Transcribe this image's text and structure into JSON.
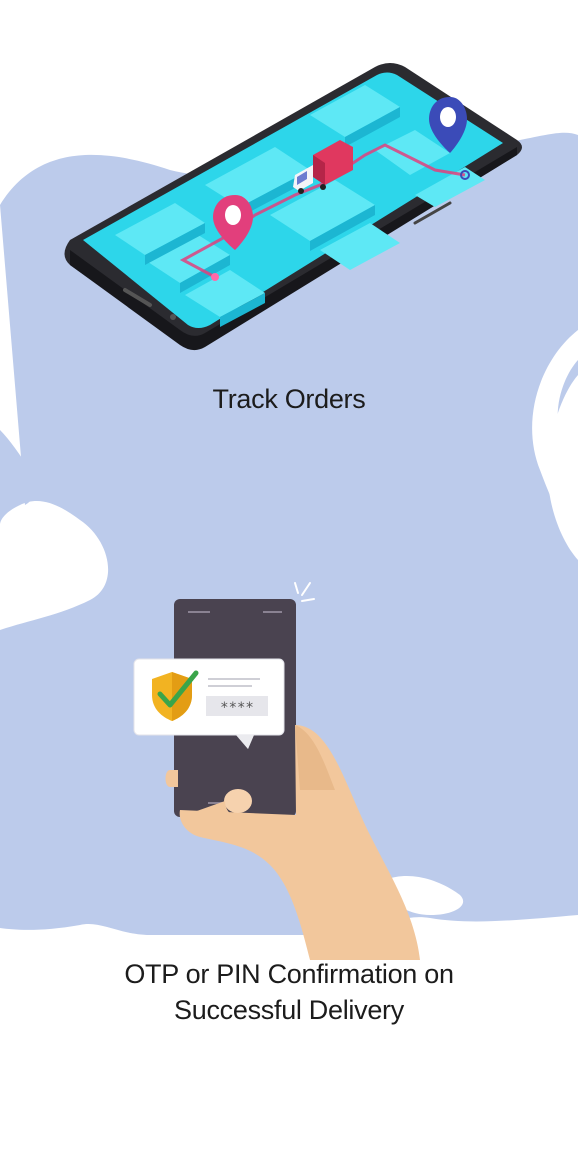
{
  "features": [
    {
      "title": "Track Orders",
      "illustration_icon": "delivery-tracking-map-phone"
    },
    {
      "title_line1": "OTP or PIN Confirmation on",
      "title_line2": "Successful Delivery",
      "illustration_icon": "hand-holding-phone-otp-verification",
      "pin_mask": "****"
    }
  ],
  "colors": {
    "background": "#ffffff",
    "blob": "#bccbeb",
    "map_cyan": "#2dd6ea",
    "pin_pink": "#e23f7c",
    "pin_blue": "#3b4bb8",
    "phone_dark": "#4a4350",
    "skin": "#f2c79c",
    "shield_gold": "#f2b322",
    "check_green": "#3aa54a"
  }
}
